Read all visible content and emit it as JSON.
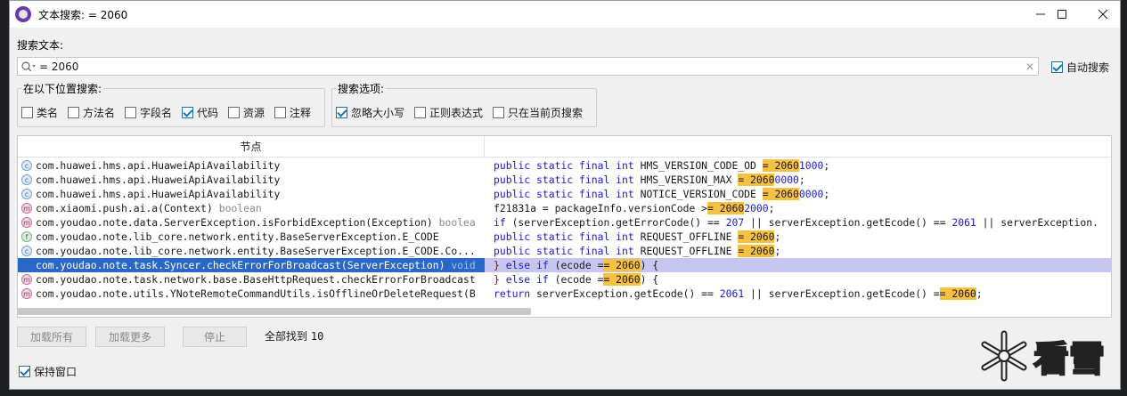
{
  "window": {
    "title": "文本搜索: = 2060"
  },
  "search": {
    "label": "搜索文本:",
    "value": "= 2060",
    "auto_search_label": "自动搜索",
    "auto_search_checked": true
  },
  "location_group": {
    "legend": "在以下位置搜索:",
    "options": [
      {
        "label": "类名",
        "checked": false
      },
      {
        "label": "方法名",
        "checked": false
      },
      {
        "label": "字段名",
        "checked": false
      },
      {
        "label": "代码",
        "checked": true
      },
      {
        "label": "资源",
        "checked": false
      },
      {
        "label": "注释",
        "checked": false
      }
    ]
  },
  "search_options_group": {
    "legend": "搜索选项:",
    "options": [
      {
        "label": "忽略大小写",
        "checked": true
      },
      {
        "label": "正则表达式",
        "checked": false
      },
      {
        "label": "只在当前页搜索",
        "checked": false
      }
    ]
  },
  "table": {
    "header_node": "节点",
    "rows": [
      {
        "icon": "class",
        "node": "com.huawei.hms.api.HuaweiApiAvailability",
        "suffix": "",
        "code": [
          [
            "kw",
            "public static final int "
          ],
          [
            "t",
            "HMS_VERSION_CODE_OD "
          ],
          [
            "hl",
            "= 2060"
          ],
          [
            "num",
            "1000"
          ],
          [
            "t",
            ";"
          ]
        ]
      },
      {
        "icon": "class",
        "node": "com.huawei.hms.api.HuaweiApiAvailability",
        "suffix": "",
        "code": [
          [
            "kw",
            "public static final int "
          ],
          [
            "t",
            "HMS_VERSION_MAX "
          ],
          [
            "hl",
            "= 2060"
          ],
          [
            "num",
            "0000"
          ],
          [
            "t",
            ";"
          ]
        ]
      },
      {
        "icon": "class",
        "node": "com.huawei.hms.api.HuaweiApiAvailability",
        "suffix": "",
        "code": [
          [
            "kw",
            "public static final int "
          ],
          [
            "t",
            "NOTICE_VERSION_CODE "
          ],
          [
            "hl",
            "= 2060"
          ],
          [
            "num",
            "0000"
          ],
          [
            "t",
            ";"
          ]
        ]
      },
      {
        "icon": "method",
        "node": "com.xiaomi.push.ai.a(Context)",
        "suffix": " boolean",
        "code": [
          [
            "t",
            "f21831a = packageInfo.versionCode >"
          ],
          [
            "hl",
            "= 2060"
          ],
          [
            "num",
            "2000"
          ],
          [
            "t",
            ";"
          ]
        ]
      },
      {
        "icon": "method",
        "node": "com.youdao.note.data.ServerException.isForbidException(Exception)",
        "suffix": " boolea",
        "code": [
          [
            "kw",
            "if "
          ],
          [
            "t",
            "(serverException.getErrorCode() == "
          ],
          [
            "num",
            "207"
          ],
          [
            "t",
            " || serverException.getEcode() == "
          ],
          [
            "num",
            "2061"
          ],
          [
            "t",
            " || serverException."
          ]
        ]
      },
      {
        "icon": "field",
        "node": "com.youdao.note.lib_core.network.entity.BaseServerException.E_CODE",
        "suffix": "",
        "code": [
          [
            "kw",
            "public static final int "
          ],
          [
            "t",
            "REQUEST_OFFLINE "
          ],
          [
            "hl",
            "= 2060"
          ],
          [
            "t",
            ";"
          ]
        ]
      },
      {
        "icon": "class",
        "node": "com.youdao.note.lib_core.network.entity.BaseServerException.E_CODE.Co...",
        "suffix": "",
        "code": [
          [
            "kw",
            "public static final int "
          ],
          [
            "t",
            "REQUEST_OFFLINE "
          ],
          [
            "hl",
            "= 2060"
          ],
          [
            "t",
            ";"
          ]
        ]
      },
      {
        "icon": "method",
        "node": "com.youdao.note.task.Syncer.checkErrorForBroadcast(ServerException)",
        "suffix": " void",
        "selected": true,
        "code": [
          [
            "brk",
            "} "
          ],
          [
            "kw",
            "else if "
          ],
          [
            "t",
            "(ecode "
          ],
          [
            "t",
            "="
          ],
          [
            "hl",
            "= 2060"
          ],
          [
            "t",
            ") {"
          ]
        ]
      },
      {
        "icon": "method",
        "node": "com.youdao.note.task.network.base.BaseHttpRequest.checkErrorForBroadcast",
        "suffix": "",
        "code": [
          [
            "brk",
            "} "
          ],
          [
            "kw",
            "else if "
          ],
          [
            "t",
            "(ecode "
          ],
          [
            "t",
            "="
          ],
          [
            "hl",
            "= 2060"
          ],
          [
            "t",
            ") {"
          ]
        ]
      },
      {
        "icon": "method",
        "node": "com.youdao.note.utils.YNoteRemoteCommandUtils.isOfflineOrDeleteRequest(B",
        "suffix": "",
        "code": [
          [
            "kw",
            "return "
          ],
          [
            "t",
            "serverException.getEcode() == "
          ],
          [
            "num",
            "2061"
          ],
          [
            "t",
            " || serverException.getEcode() "
          ],
          [
            "t",
            "="
          ],
          [
            "hl",
            "= 2060"
          ],
          [
            "t",
            ";"
          ]
        ]
      }
    ]
  },
  "buttons": {
    "load_all": "加载所有",
    "load_more": "加载更多",
    "stop": "停止"
  },
  "status": {
    "found_label": "全部找到",
    "found_count": "10"
  },
  "keep_window": {
    "label": "保持窗口",
    "checked": true
  },
  "watermark": {
    "text": "看雪"
  }
}
